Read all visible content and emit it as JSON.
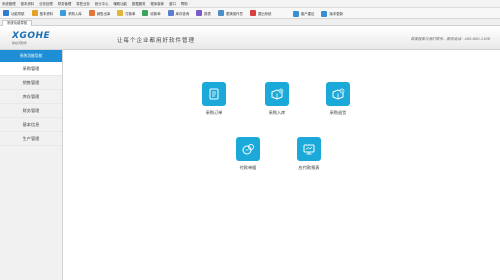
{
  "menu": [
    "系统管理",
    "基本资料",
    "业务处理",
    "财务管理",
    "零售业务",
    "统计中心",
    "辅助功能",
    "数据服务",
    "程序窗体",
    "窗口",
    "帮助"
  ],
  "toolbar": [
    {
      "label": "功能导航",
      "color": "#2e7bd0",
      "icon": "home-icon"
    },
    {
      "label": "基本资料",
      "color": "#e5a22a",
      "icon": "folder-icon"
    },
    {
      "label": "采购入库",
      "color": "#3b9bdb",
      "icon": "inbound-icon"
    },
    {
      "label": "销售出库",
      "color": "#e0773a",
      "icon": "outbound-icon"
    },
    {
      "label": "付款单",
      "color": "#e2b63a",
      "icon": "payment-icon"
    },
    {
      "label": "收款单",
      "color": "#3aa35d",
      "icon": "receipt-icon"
    },
    {
      "label": "库存查询",
      "color": "#5a7fd1",
      "icon": "stock-icon"
    },
    {
      "label": "报表",
      "color": "#7a5bc8",
      "icon": "report-icon"
    },
    {
      "label": "更换操作员",
      "color": "#4c8fc8",
      "icon": "user-switch-icon"
    },
    {
      "label": "退出系统",
      "color": "#d9413a",
      "icon": "exit-icon"
    }
  ],
  "toolbar_right": [
    {
      "label": "客户建议",
      "color": "#3a8ed6",
      "icon": "suggestion-icon"
    },
    {
      "label": "版本更新",
      "color": "#3a8ed6",
      "icon": "update-icon"
    }
  ],
  "tab": "系统功能导航",
  "logo": {
    "name": "XGOHE",
    "sub": "新谷河软件"
  },
  "slogan": "让每个企业都用好软件管理",
  "hotline": "百度搜索与我们联系，服务电话：400-600-1168",
  "sidebar": {
    "header": "系统功能导航",
    "items": [
      "采购管理",
      "销售管理",
      "库存管理",
      "财务管理",
      "基本信息",
      "生产管理"
    ]
  },
  "functions": [
    {
      "label": "采购订单",
      "icon": "purchase-order-icon"
    },
    {
      "label": "采购入库",
      "icon": "purchase-inbound-icon"
    },
    {
      "label": "采购退货",
      "icon": "purchase-return-icon"
    },
    {
      "label": "付款单据",
      "icon": "payment-voucher-icon"
    },
    {
      "label": "应付款报表",
      "icon": "payables-report-icon"
    }
  ],
  "colors": {
    "accent": "#1e8fd6",
    "tile": "#1aa9d8"
  }
}
